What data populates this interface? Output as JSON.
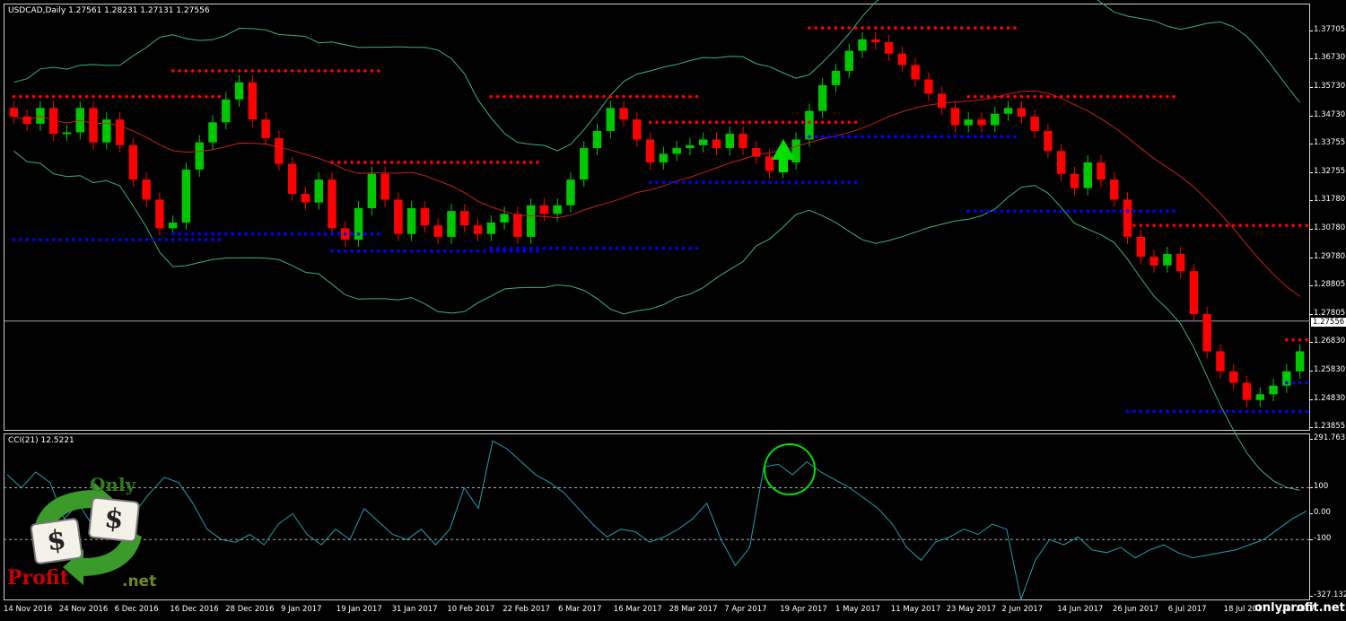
{
  "symbol_header": "USDCAD,Daily  1.27561 1.28231 1.27131 1.27556",
  "cci_header": "CCI(21) 12.5221",
  "price_axis": [
    "1.37705",
    "1.36730",
    "1.35730",
    "1.34730",
    "1.33755",
    "1.32755",
    "1.31780",
    "1.30780",
    "1.29780",
    "1.28805",
    "1.27805",
    "1.26830",
    "1.25830",
    "1.24830",
    "1.23855"
  ],
  "current_price": "1.27556",
  "cci_axis": [
    "291.7637",
    "100",
    "0.00",
    "-100",
    "-327.1320"
  ],
  "time_axis": [
    "14 Nov 2016",
    "24 Nov 2016",
    "6 Dec 2016",
    "16 Dec 2016",
    "28 Dec 2016",
    "9 Jan 2017",
    "19 Jan 2017",
    "31 Jan 2017",
    "10 Feb 2017",
    "22 Feb 2017",
    "6 Mar 2017",
    "16 Mar 2017",
    "28 Mar 2017",
    "7 Apr 2017",
    "19 Apr 2017",
    "1 May 2017",
    "11 May 2017",
    "23 May 2017",
    "2 Jun 2017",
    "14 Jun 2017",
    "26 Jun 2017",
    "6 Jul 2017",
    "18 Jul 2017",
    "..Jul 2017"
  ],
  "logo": {
    "only": "Only",
    "dollar": "$",
    "profit": "Profit",
    "net": ".net"
  },
  "watermark": "onlyprofit.net",
  "colors": {
    "bull": "#00c800",
    "bear": "#ff0000",
    "resistance_dots": "#ff0000",
    "support_dots": "#0000ff",
    "bands": "#3cb371",
    "ma": "#c81e1e",
    "cci": "#20a0b0",
    "signal": "#00e000"
  },
  "chart_data": {
    "type": "candlestick",
    "instrument": "USDCAD",
    "timeframe": "Daily",
    "ohlc_header": {
      "open": 1.27561,
      "high": 1.28231,
      "low": 1.27131,
      "close": 1.27556
    },
    "ylim": [
      1.2385,
      1.3821
    ],
    "close_path": [
      1.347,
      1.3445,
      1.35,
      1.341,
      1.3415,
      1.35,
      1.338,
      1.346,
      1.337,
      1.325,
      1.318,
      1.308,
      1.31,
      1.3285,
      1.338,
      1.345,
      1.353,
      1.359,
      1.346,
      1.3395,
      1.3305,
      1.32,
      1.317,
      1.325,
      1.308,
      1.304,
      1.315,
      1.327,
      1.318,
      1.306,
      1.315,
      1.309,
      1.305,
      1.314,
      1.309,
      1.306,
      1.31,
      1.313,
      1.305,
      1.316,
      1.313,
      1.316,
      1.325,
      1.336,
      1.342,
      1.35,
      1.346,
      1.339,
      1.331,
      1.334,
      1.336,
      1.337,
      1.339,
      1.336,
      1.341,
      1.336,
      1.333,
      1.328,
      1.331,
      1.339,
      1.349,
      1.358,
      1.363,
      1.37,
      1.374,
      1.373,
      1.369,
      1.365,
      1.36,
      1.355,
      1.35,
      1.344,
      1.346,
      1.344,
      1.348,
      1.35,
      1.347,
      1.342,
      1.335,
      1.327,
      1.322,
      1.331,
      1.325,
      1.318,
      1.305,
      1.298,
      1.295,
      1.299,
      1.293,
      1.278,
      1.265,
      1.258,
      1.254,
      1.248,
      1.25,
      1.253,
      1.258,
      1.265
    ],
    "cci_ylim": [
      -327.132,
      291.7637
    ],
    "cci_levels": [
      100,
      0,
      -100
    ],
    "cci_current": 12.5221,
    "cci_path": [
      150,
      100,
      160,
      120,
      -20,
      40,
      -50,
      -60,
      -40,
      10,
      80,
      140,
      120,
      40,
      -60,
      -100,
      -110,
      -80,
      -120,
      -40,
      0,
      -80,
      -120,
      -60,
      -100,
      20,
      -30,
      -80,
      -100,
      -60,
      -120,
      -60,
      100,
      20,
      280,
      250,
      200,
      150,
      120,
      80,
      20,
      -40,
      -90,
      -60,
      -70,
      -110,
      -90,
      -60,
      -20,
      40,
      -100,
      -200,
      -130,
      180,
      190,
      150,
      200,
      160,
      130,
      100,
      60,
      20,
      -40,
      -130,
      -180,
      -110,
      -90,
      -60,
      -80,
      -40,
      -60,
      -330,
      -180,
      -100,
      -120,
      -90,
      -140,
      -150,
      -130,
      -170,
      -140,
      -120,
      -150,
      -170,
      -160,
      -150,
      -140,
      -120,
      -100,
      -60,
      -20,
      10
    ]
  }
}
